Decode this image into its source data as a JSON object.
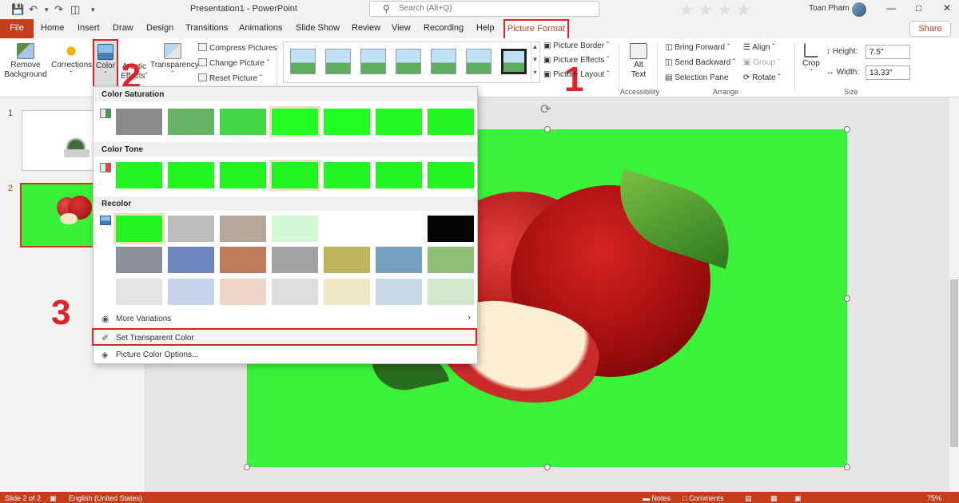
{
  "window": {
    "title": "Presentation1 - PowerPoint",
    "search_placeholder": "Search (Alt+Q)",
    "user": "Toan Pham"
  },
  "tabs": {
    "file": "File",
    "items": [
      "Home",
      "Insert",
      "Draw",
      "Design",
      "Transitions",
      "Animations",
      "Slide Show",
      "Review",
      "View",
      "Recording",
      "Help"
    ],
    "active": "Picture Format",
    "share": "Share"
  },
  "ribbon": {
    "remove_bg": [
      "Remove",
      "Background"
    ],
    "corrections": "Corrections",
    "color": "Color",
    "artistic": [
      "Artistic",
      "Effects"
    ],
    "transparency": "Transparency",
    "compress": "Compress Pictures",
    "change": "Change Picture",
    "reset": "Reset Picture",
    "border": "Picture Border",
    "effects": "Picture Effects",
    "layout": "Picture Layout",
    "alt_text": [
      "Alt",
      "Text"
    ],
    "bring_forward": "Bring Forward",
    "send_backward": "Send Backward",
    "selection_pane": "Selection Pane",
    "align": "Align",
    "group": "Group",
    "rotate": "Rotate",
    "crop": "Crop",
    "height_label": "Height:",
    "height": "7.5\"",
    "width_label": "Width:",
    "width": "13.33\"",
    "groups": {
      "accessibility": "Accessibility",
      "arrange": "Arrange",
      "size": "Size"
    }
  },
  "annotations": {
    "step1": "1",
    "step2": "2",
    "step3": "3"
  },
  "slides": [
    "1",
    "2"
  ],
  "dropdown": {
    "color_saturation": "Color Saturation",
    "saturation_swatches": [
      "#8a8a8a",
      "#66b366",
      "#44d644",
      "#22ff22",
      "#20fb20",
      "#20f820",
      "#22f522"
    ],
    "color_tone": "Color Tone",
    "tone_swatches": [
      "#22f522",
      "#22f522",
      "#22f522",
      "#22f522",
      "#22f522",
      "#22f522",
      "#22f522"
    ],
    "recolor": "Recolor",
    "recolor_rows": [
      [
        "#22f522",
        "#bdbdbd",
        "#b5a89a",
        "#d4f7d4",
        null,
        null,
        "#050505"
      ],
      [
        "#8a8f99",
        "#7086bf",
        "#bd7c5c",
        "#a3a3a3",
        "#bdb45c",
        "#75a0c2",
        "#8fbf7a"
      ],
      [
        "#e3e3e3",
        "#c5d2e8",
        "#f0d6c6",
        "#dedede",
        "#f0e7c6",
        "#cbd9e6",
        "#d1e6cc"
      ]
    ],
    "more_variations": "More Variations",
    "set_transparent": "Set Transparent Color",
    "picture_color_options": "Picture Color Options..."
  },
  "status": {
    "slide": "Slide 2 of 2",
    "language": "English (United States)",
    "notes": "Notes",
    "comments": "Comments",
    "zoom": "75%"
  }
}
